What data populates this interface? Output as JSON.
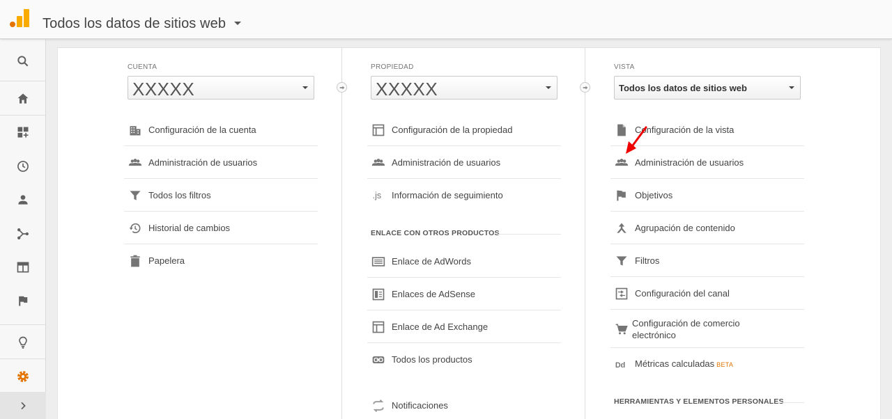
{
  "header": {
    "title": "Todos los datos de sitios web"
  },
  "nav": {
    "items": [
      "search-icon",
      "home-icon",
      "customization-icon",
      "realtime-icon",
      "audience-icon",
      "acquisition-icon",
      "behavior-icon",
      "conversions-icon",
      "discover-icon",
      "admin-icon",
      "expand-icon"
    ],
    "active_color": "#e37400"
  },
  "columns": {
    "account": {
      "label": "CUENTA",
      "selected": "XXXXX",
      "items": [
        {
          "icon": "building-icon",
          "label": "Configuración de la cuenta"
        },
        {
          "icon": "users-icon",
          "label": "Administración de usuarios"
        },
        {
          "icon": "filter-icon",
          "label": "Todos los filtros"
        },
        {
          "icon": "history-icon",
          "label": "Historial de cambios"
        },
        {
          "icon": "trash-icon",
          "label": "Papelera"
        }
      ]
    },
    "property": {
      "label": "PROPIEDAD",
      "selected": "XXXXX",
      "items": [
        {
          "icon": "property-icon",
          "label": "Configuración de la propiedad"
        },
        {
          "icon": "users-icon",
          "label": "Administración de usuarios"
        },
        {
          "icon": "js-icon",
          "label": "Información de seguimiento"
        }
      ],
      "section": "ENLACE CON OTROS PRODUCTOS",
      "links": [
        {
          "icon": "adwords-icon",
          "label": "Enlace de AdWords"
        },
        {
          "icon": "adsense-icon",
          "label": "Enlaces de AdSense"
        },
        {
          "icon": "adexchange-icon",
          "label": "Enlace de Ad Exchange"
        },
        {
          "icon": "link-icon",
          "label": "Todos los productos"
        }
      ],
      "notifications": {
        "icon": "notifications-icon",
        "label": "Notificaciones"
      }
    },
    "view": {
      "label": "VISTA",
      "selected": "Todos los datos de sitios web",
      "items": [
        {
          "icon": "document-icon",
          "label": "Configuración de la vista"
        },
        {
          "icon": "users-icon",
          "label": "Administración de usuarios"
        },
        {
          "icon": "flag-icon",
          "label": "Objetivos"
        },
        {
          "icon": "content-grouping-icon",
          "label": "Agrupación de contenido"
        },
        {
          "icon": "filter-icon",
          "label": "Filtros"
        },
        {
          "icon": "channel-settings-icon",
          "label": "Configuración del canal"
        },
        {
          "icon": "cart-icon",
          "label": "Configuración de comercio electrónico"
        },
        {
          "icon": "dd-icon",
          "label": "Métricas calculadas",
          "badge": "BETA"
        }
      ],
      "section": "HERRAMIENTAS Y ELEMENTOS PERSONALES"
    }
  }
}
